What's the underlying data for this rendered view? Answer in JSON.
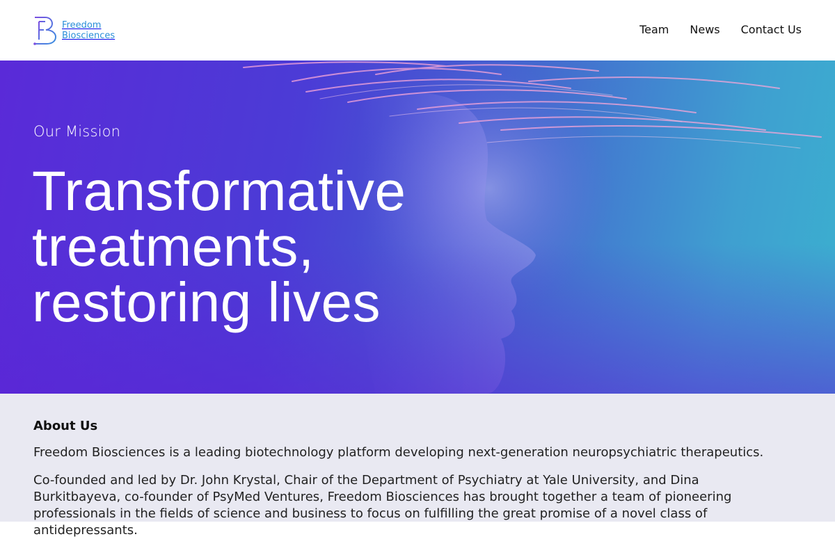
{
  "header": {
    "logo": {
      "line1": "Freedom",
      "line2": "Biosciences"
    },
    "nav": [
      {
        "label": "Team"
      },
      {
        "label": "News"
      },
      {
        "label": "Contact Us"
      }
    ]
  },
  "hero": {
    "kicker": "Our Mission",
    "headline_lines": [
      "Transformative",
      "treatments,",
      "restoring lives"
    ]
  },
  "about": {
    "title": "About Us",
    "paragraphs": [
      "Freedom Biosciences is a leading biotechnology platform developing next-generation neuropsychiatric therapeutics.",
      "Co-founded and led by Dr. John Krystal, Chair of the Department of Psychiatry at Yale University, and Dina Burkitbayeva, co-founder of PsyMed Ventures, Freedom Biosciences has brought together a team of pioneering professionals in the fields of science and business to focus on fulfilling the great promise of a novel class of antidepressants."
    ]
  },
  "colors": {
    "brand_blue": "#2a8fd8",
    "logo_purple": "#6b4ee0",
    "hero_start": "#5a2ad8",
    "hero_end": "#3bb0cf",
    "about_bg": "#e9e9f2"
  },
  "icons": {
    "logo": "fb-monogram-logo"
  }
}
